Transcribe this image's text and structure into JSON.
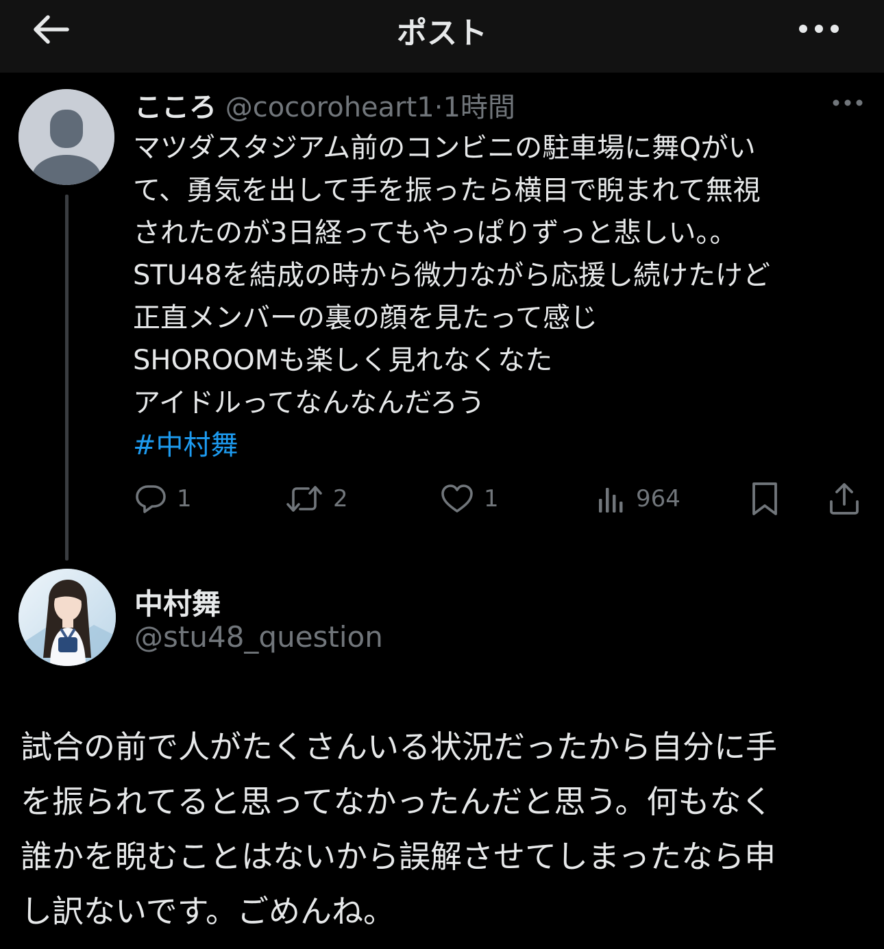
{
  "header": {
    "title": "ポスト",
    "back_icon": "arrow-left-icon",
    "more_icon": "more-horizontal-icon"
  },
  "post": {
    "display_name": "こころ",
    "handle": "@cocoroheart1",
    "separator": "·",
    "time": "1時間",
    "lines": [
      "マツダスタジアム前のコンビニの駐車場に舞Qがい",
      "て、勇気を出して手を振ったら横目で睨まれて無視",
      "されたのが3日経ってもやっぱりずっと悲しい。。",
      "STU48を結成の時から微力ながら応援し続けたけど",
      "正直メンバーの裏の顔を見たって感じ",
      "SHOROOMも楽しく見れなくなた",
      "アイドルってなんなんだろう"
    ],
    "hashtag": "#中村舞",
    "actions": {
      "reply_count": "1",
      "repost_count": "2",
      "like_count": "1",
      "views_count": "964"
    }
  },
  "reply": {
    "display_name": "中村舞",
    "handle": "@stu48_question",
    "lines": [
      "試合の前で人がたくさんいる状況だったから自分に手",
      "を振られてると思ってなかったんだと思う。何もなく",
      "誰かを睨むことはないから誤解させてしまったなら申",
      "し訳ないです。ごめんね。"
    ]
  },
  "colors": {
    "background": "#000000",
    "header_bg": "#121212",
    "text": "#e7e9ea",
    "secondary": "#71767b",
    "hashtag": "#1d9bf0"
  }
}
